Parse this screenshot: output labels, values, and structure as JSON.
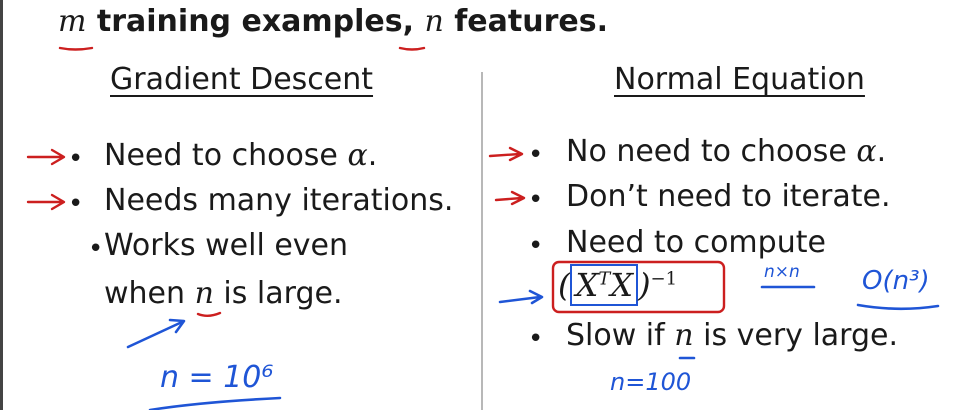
{
  "header": {
    "m_var": "m",
    "text_1": " training examples, ",
    "n_var": "n",
    "text_2": " features."
  },
  "left": {
    "heading": "Gradient Descent",
    "items": [
      {
        "text": "Need to choose ",
        "math": "α",
        "after": "."
      },
      {
        "text": "Needs many iterations."
      },
      {
        "line1": "Works well even",
        "line2_a": "when ",
        "line2_math": "n",
        "line2_b": " is large."
      }
    ],
    "handwritten_note": "n = 10⁶"
  },
  "right": {
    "heading": "Normal Equation",
    "items": [
      {
        "text": "No need to choose ",
        "math": "α",
        "after": "."
      },
      {
        "text": "Don’t need to iterate."
      },
      {
        "text": "Need to compute"
      },
      {
        "math_open": "(",
        "math_inner": "X",
        "math_sup": "T",
        "math_inner2": "X",
        "math_close": ")",
        "math_exp": "−1"
      },
      {
        "text_a": "Slow if ",
        "math": "n",
        "text_b": " is very large."
      }
    ],
    "handwritten_dims": "n×n",
    "handwritten_complexity": "O(n³)",
    "handwritten_note": "n=100"
  },
  "colors": {
    "accent_red": "#cc1f1f",
    "accent_blue": "#1f55d6",
    "divider": "#b8b8b8"
  }
}
